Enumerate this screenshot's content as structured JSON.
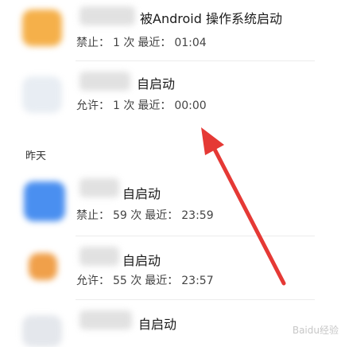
{
  "section_yesterday": "昨天",
  "items": [
    {
      "title": "被Android 操作系统启动",
      "status": "禁止：",
      "count": "1 次",
      "recent_label": "最近：",
      "time": "01:04",
      "icon_color": "#f5b04a"
    },
    {
      "title": "自启动",
      "status": "允许：",
      "count": "1 次",
      "recent_label": "最近：",
      "time": "00:00",
      "icon_color": "#e8edf3"
    },
    {
      "title": "自启动",
      "status": "禁止：",
      "count": "59 次",
      "recent_label": "最近：",
      "time": "23:59",
      "icon_color": "#4a8ff0"
    },
    {
      "title": "自启动",
      "status": "允许：",
      "count": "55 次",
      "recent_label": "最近：",
      "time": "23:57",
      "icon_color": "#f0a04a"
    },
    {
      "title": "自启动",
      "status": "",
      "count": "",
      "recent_label": "",
      "time": "",
      "icon_color": "#e4e7ec"
    }
  ],
  "colors": {
    "arrow": "#e53935"
  },
  "watermark": "Baidu经验"
}
